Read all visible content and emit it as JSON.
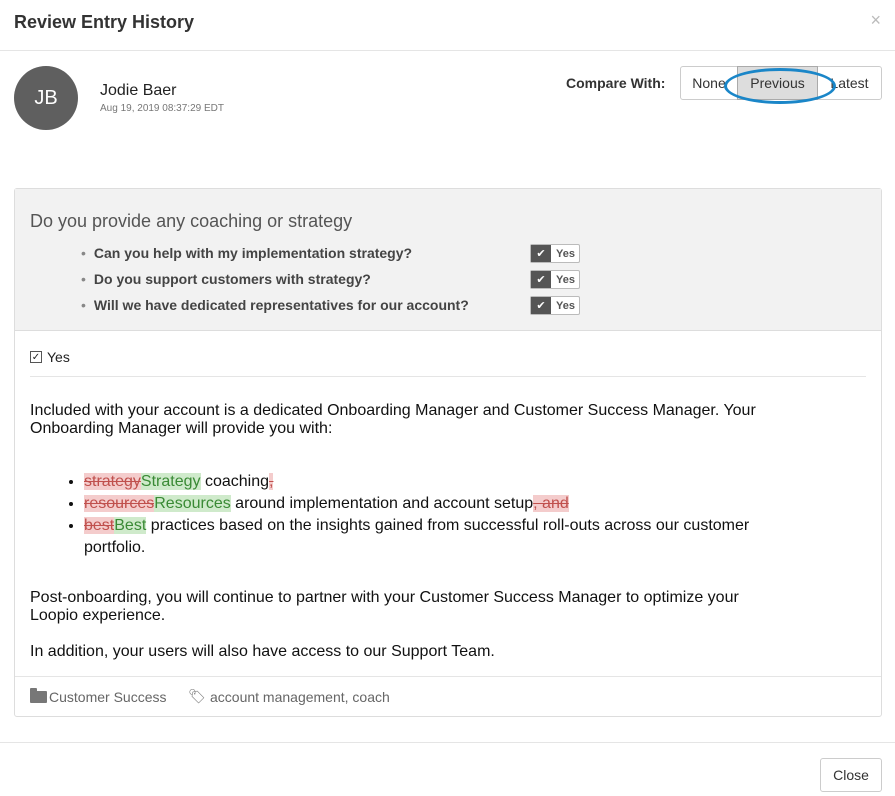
{
  "modal": {
    "title": "Review Entry History",
    "close_symbol": "×"
  },
  "author": {
    "initials": "JB",
    "name": "Jodie Baer",
    "date": "Aug 19, 2019 08:37:29 EDT"
  },
  "compare": {
    "label": "Compare With:",
    "options": [
      "None",
      "Previous",
      "Latest"
    ],
    "selected": "Previous"
  },
  "question": {
    "title": "Do you provide any coaching or strategy",
    "alternates": [
      {
        "text": "Can you help with my implementation strategy?",
        "tag": "Yes"
      },
      {
        "text": "Do you support customers with strategy?",
        "tag": "Yes"
      },
      {
        "text": "Will we have dedicated representatives for our account?",
        "tag": "Yes"
      }
    ]
  },
  "answer": {
    "check_label": "Yes",
    "intro": "Included with your account is a dedicated Onboarding Manager and Customer Success Manager. Your Onboarding Manager will provide you with:",
    "bullets": [
      {
        "removed": "strategy",
        "added": "Strategy",
        "text": " coaching",
        "removed_tail": ","
      },
      {
        "removed": "resources",
        "added": "Resources",
        "text": " around implementation and account setup",
        "removed_tail": ", and"
      },
      {
        "removed": "best",
        "added": "Best",
        "text": " practices based on the insights gained from successful roll-outs across our customer portfolio."
      }
    ],
    "post": "Post-onboarding, you will continue to partner with your Customer Success Manager to optimize your Loopio experience.",
    "support": "In addition, your users will also have access to our Support Team."
  },
  "meta": {
    "category": "Customer Success",
    "tags": "account management, coach"
  },
  "footer": {
    "close_label": "Close"
  },
  "colors": {
    "accent": "#1a86c8",
    "removed_bg": "#f4cccc",
    "added_bg": "#cfeacb"
  }
}
